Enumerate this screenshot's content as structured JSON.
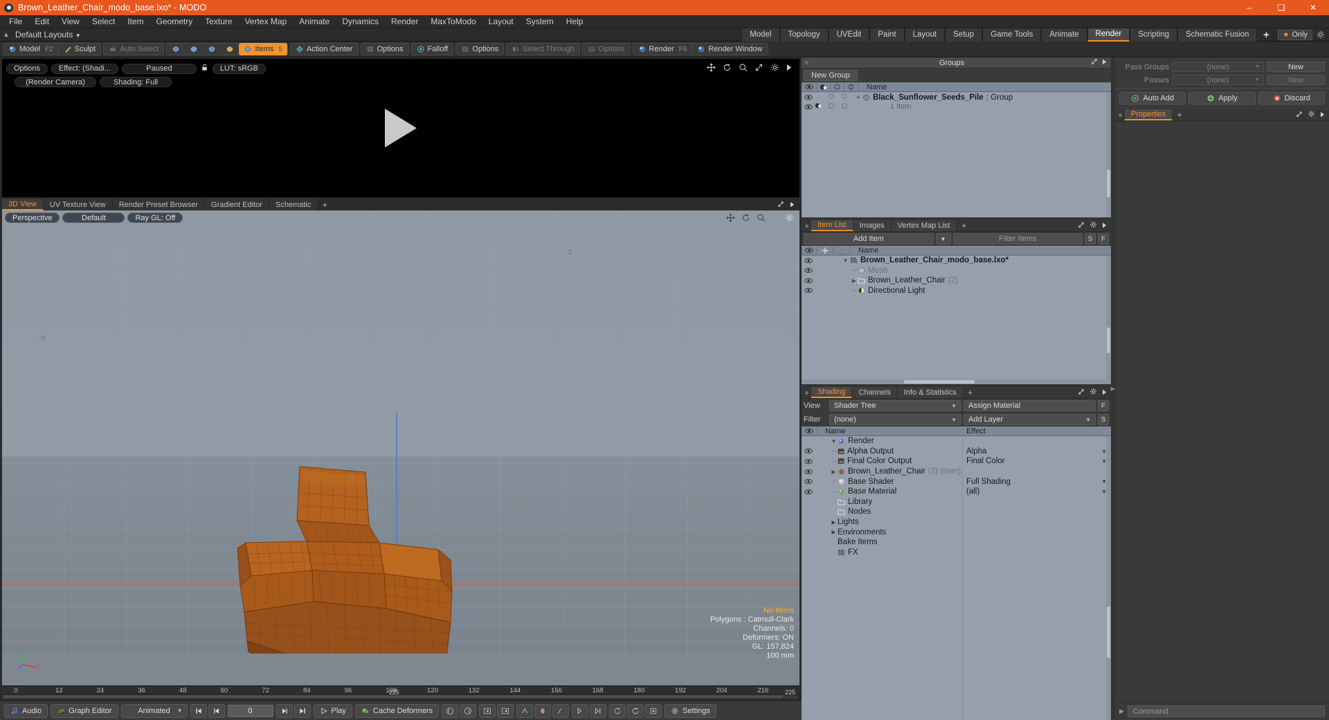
{
  "titlebar": {
    "title": "Brown_Leather_Chair_modo_base.lxo* - MODO",
    "minimize": "–",
    "maximize": "❑",
    "close": "✕"
  },
  "menubar": {
    "items": [
      "File",
      "Edit",
      "View",
      "Select",
      "Item",
      "Geometry",
      "Texture",
      "Vertex Map",
      "Animate",
      "Dynamics",
      "Render",
      "MaxToModo",
      "Layout",
      "System",
      "Help"
    ]
  },
  "layoutbar": {
    "default_layouts": "Default Layouts",
    "tabs": [
      "Model",
      "Topology",
      "UVEdit",
      "Paint",
      "Layout",
      "Setup",
      "Game Tools",
      "Animate",
      "Render",
      "Scripting",
      "Schematic Fusion"
    ],
    "active_tab": "Render",
    "plus": "+",
    "only_label": "Only"
  },
  "toolbar": {
    "model": "Model",
    "model_key": "F2",
    "sculpt": "Sculpt",
    "auto_select": "Auto Select",
    "items": "Items",
    "items_key": "5",
    "action_center": "Action Center",
    "options1": "Options",
    "falloff": "Falloff",
    "options2": "Options",
    "select_through": "Select Through",
    "options3": "Options",
    "render": "Render",
    "render_key": "F9",
    "render_window": "Render Window"
  },
  "preview": {
    "options": "Options",
    "effect": "Effect: (Shadi...",
    "paused": "Paused",
    "lut": "LUT: sRGB",
    "camera": "(Render Camera)",
    "shading": "Shading: Full"
  },
  "viewtabs": {
    "tabs": [
      "3D View",
      "UV Texture View",
      "Render Preset Browser",
      "Gradient Editor",
      "Schematic"
    ],
    "active": "3D View",
    "plus": "+"
  },
  "viewport": {
    "perspective": "Perspective",
    "default": "Default",
    "raygl": "Ray GL: Off",
    "axis_labels": {
      "neg_z": "-Z",
      "neg_x": "-X"
    },
    "stats": {
      "no_items": "No Items",
      "polygons": "Polygons : Catmull-Clark",
      "channels": "Channels: 0",
      "deformers": "Deformers: ON",
      "gl": "GL: 157,824",
      "scale": "100 mm"
    }
  },
  "timeline": {
    "ticks": [
      "0",
      "12",
      "24",
      "36",
      "48",
      "60",
      "72",
      "84",
      "96",
      "108",
      "120",
      "132",
      "144",
      "156",
      "168",
      "180",
      "192",
      "204",
      "216"
    ],
    "start": "0",
    "end": "225",
    "center": "225"
  },
  "bottombar": {
    "audio": "Audio",
    "graph_editor": "Graph Editor",
    "animated": "Animated",
    "frame": "0",
    "play": "Play",
    "cache_deformers": "Cache Deformers",
    "settings": "Settings"
  },
  "groups_panel": {
    "title": "Groups",
    "new_group": "New Group",
    "columns": [
      "Name"
    ],
    "rows": [
      {
        "name": "Black_Sunflower_Seeds_Pile",
        "suffix": ": Group",
        "sub": "1 Item"
      }
    ]
  },
  "item_list_panel": {
    "tabs": [
      "Item List",
      "Images",
      "Vertex Map List"
    ],
    "active_tab": "Item List",
    "plus": "+",
    "add_item": "Add Item",
    "filter_items": "Filter Items",
    "btn_s": "S",
    "btn_f": "F",
    "columns": [
      "Name"
    ],
    "rows": [
      {
        "name": "Brown_Leather_Chair_modo_base.lxo*",
        "indent": 0,
        "bold": true,
        "icon": "film-icon",
        "muted": false,
        "count": ""
      },
      {
        "name": "Mesh",
        "indent": 1,
        "bold": false,
        "icon": "mesh-icon",
        "muted": true,
        "count": ""
      },
      {
        "name": "Brown_Leather_Chair",
        "indent": 1,
        "bold": false,
        "icon": "folder-icon",
        "muted": false,
        "count": "(2)"
      },
      {
        "name": "Directional Light",
        "indent": 1,
        "bold": false,
        "icon": "light-icon",
        "muted": false,
        "count": ""
      }
    ]
  },
  "shading_panel": {
    "tabs": [
      "Shading",
      "Channels",
      "Info & Statistics"
    ],
    "active_tab": "Shading",
    "plus": "+",
    "view_label": "View",
    "view_value": "Shader Tree",
    "assign_material": "Assign Material",
    "btn_f": "F",
    "filter_label": "Filter",
    "filter_value": "(none)",
    "add_layer": "Add Layer",
    "btn_s": "S",
    "col_name": "Name",
    "col_effect": "Effect",
    "rows": [
      {
        "name": "Render",
        "effect": "",
        "indent": 0,
        "icon": "sphere-blue-icon",
        "eye": false,
        "note": ""
      },
      {
        "name": "Alpha Output",
        "effect": "Alpha",
        "indent": 2,
        "icon": "image-icon",
        "eye": true,
        "note": ""
      },
      {
        "name": "Final Color Output",
        "effect": "Final Color",
        "indent": 2,
        "icon": "image-icon",
        "eye": true,
        "note": ""
      },
      {
        "name": "Brown_Leather_Chair",
        "effect": "",
        "indent": 2,
        "icon": "sphere-red-icon",
        "eye": true,
        "note": "(2) (Item)"
      },
      {
        "name": "Base Shader",
        "effect": "Full Shading",
        "indent": 2,
        "icon": "sphere-white-icon",
        "eye": true,
        "note": ""
      },
      {
        "name": "Base Material",
        "effect": "(all)",
        "indent": 2,
        "icon": "sphere-green-icon",
        "eye": true,
        "note": ""
      },
      {
        "name": "Library",
        "effect": "",
        "indent": 1,
        "icon": "folder-icon",
        "eye": false,
        "note": ""
      },
      {
        "name": "Nodes",
        "effect": "",
        "indent": 1,
        "icon": "folder-icon",
        "eye": false,
        "note": ""
      },
      {
        "name": "Lights",
        "effect": "",
        "indent": 0,
        "icon": "triangle-icon",
        "eye": false,
        "note": ""
      },
      {
        "name": "Environments",
        "effect": "",
        "indent": 0,
        "icon": "triangle-icon",
        "eye": false,
        "note": ""
      },
      {
        "name": "Bake Items",
        "effect": "",
        "indent": 1,
        "icon": "none",
        "eye": false,
        "note": ""
      },
      {
        "name": "FX",
        "effect": "",
        "indent": 1,
        "icon": "film-icon",
        "eye": false,
        "note": ""
      }
    ]
  },
  "passes_panel": {
    "pass_groups_label": "Pass Groups",
    "pass_groups_value": "(none)",
    "pass_groups_new": "New",
    "passes_label": "Passes",
    "passes_value": "(none)",
    "passes_new": "New",
    "auto_add": "Auto Add",
    "apply": "Apply",
    "discard": "Discard"
  },
  "properties_panel": {
    "tabs": [
      "Properties"
    ],
    "active_tab": "Properties",
    "plus": "+"
  },
  "command_bar": {
    "placeholder": "Command"
  },
  "colors": {
    "accent": "#f2922d",
    "title_bar": "#e8581c",
    "list_bg": "#969fab",
    "list_header": "#7e8896"
  }
}
